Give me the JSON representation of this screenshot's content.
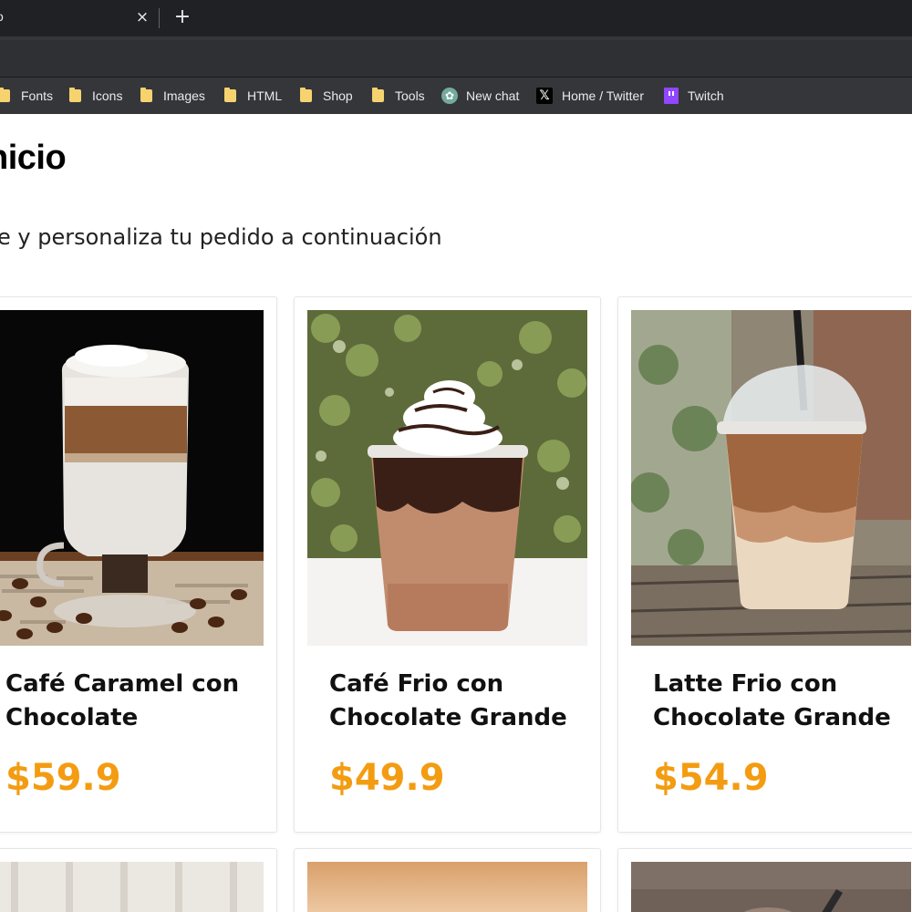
{
  "browser": {
    "tab_title": "o",
    "tab_close_glyph": "×",
    "new_tab_glyph": "+"
  },
  "bookmarks": [
    {
      "label": "Fonts",
      "icon": "folder-icon"
    },
    {
      "label": "Icons",
      "icon": "folder-icon"
    },
    {
      "label": "Images",
      "icon": "folder-icon"
    },
    {
      "label": "HTML",
      "icon": "folder-icon"
    },
    {
      "label": "Shop",
      "icon": "folder-icon"
    },
    {
      "label": "Tools",
      "icon": "folder-icon"
    },
    {
      "label": "New chat",
      "icon": "chatgpt-icon"
    },
    {
      "label": "Home / Twitter",
      "icon": "x-logo-icon"
    },
    {
      "label": "Twitch",
      "icon": "twitch-icon"
    }
  ],
  "page": {
    "title": "nicio",
    "subtitle": "e y personaliza tu pedido a continuación"
  },
  "products": [
    {
      "name": "Café Caramel con Chocolate",
      "price": "$59.9"
    },
    {
      "name": "Café Frio con Chocolate Grande",
      "price": "$49.9"
    },
    {
      "name": "Latte Frio con Chocolate Grande",
      "price": "$54.9"
    }
  ],
  "colors": {
    "price": "#f39c12",
    "chrome_dark": "#202124",
    "bookmarks_bar": "#35363a"
  }
}
